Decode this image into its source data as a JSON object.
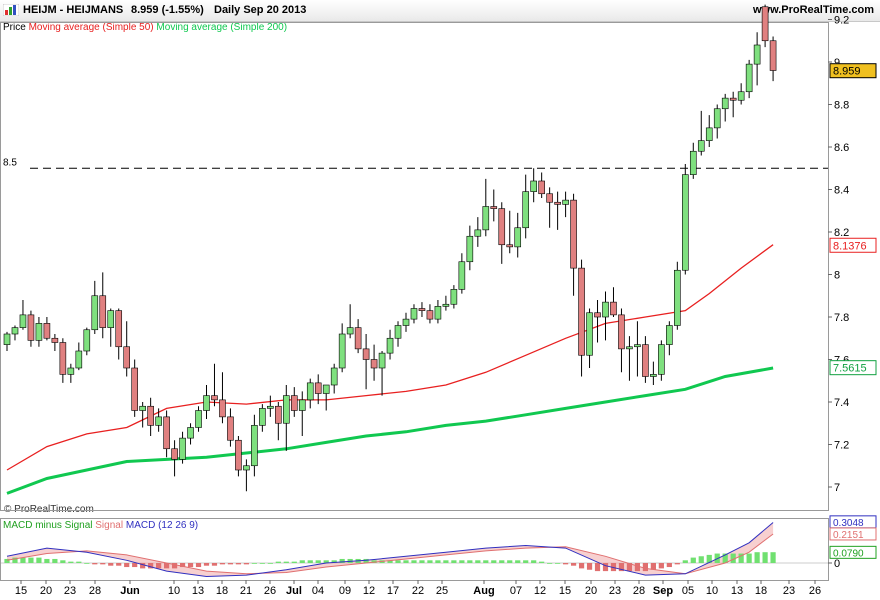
{
  "header": {
    "title": "HEIJM - HEIJMANS",
    "quote": "8.959 (-1.55%)",
    "period": "Daily  Sep 20 2013",
    "site": "www.ProRealTime.com"
  },
  "legend": {
    "price_label": "Price",
    "ma50_label": "Moving average (Simple 50)",
    "ma200_label": "Moving average (Simple 200)",
    "macd_hist_label": "MACD minus Signal",
    "macd_signal_label": "Signal",
    "macd_label": "MACD (12 26 9)"
  },
  "watermark": "© ProRealTime.com",
  "colors": {
    "up": "#7fe07f",
    "down": "#e08080",
    "ma50": "#e82020",
    "ma200": "#10c850",
    "macd_line": "#3030c0",
    "signal_line": "#e07070",
    "hist": "#70e070"
  },
  "chart_data": [
    {
      "type": "candlestick",
      "title": "HEIJM - HEIJMANS",
      "y_range": [
        6.85,
        9.3
      ],
      "y_ticks": [
        7,
        7.2,
        7.4,
        7.6,
        7.8,
        8,
        8.2,
        8.4,
        8.6,
        8.8,
        9,
        9.2
      ],
      "reference_line": {
        "value": 8.5,
        "label": "8.5"
      },
      "x_tick_labels": [
        "15",
        "20",
        "23",
        "28",
        "Jun",
        "10",
        "13",
        "18",
        "21",
        "26",
        "Jul",
        "04",
        "09",
        "12",
        "17",
        "22",
        "25",
        "Aug",
        "07",
        "12",
        "15",
        "20",
        "23",
        "28",
        "Sep",
        "05",
        "10",
        "13",
        "18",
        "23",
        "26"
      ],
      "last_values": {
        "price": "8.959",
        "ma50": "8.1376",
        "ma200": "7.5615"
      },
      "candles": [
        {
          "o": 7.67,
          "h": 7.73,
          "l": 7.64,
          "c": 7.72
        },
        {
          "o": 7.72,
          "h": 7.76,
          "l": 7.69,
          "c": 7.75
        },
        {
          "o": 7.75,
          "h": 7.88,
          "l": 7.74,
          "c": 7.81
        },
        {
          "o": 7.81,
          "h": 7.83,
          "l": 7.66,
          "c": 7.69
        },
        {
          "o": 7.69,
          "h": 7.8,
          "l": 7.66,
          "c": 7.77
        },
        {
          "o": 7.77,
          "h": 7.8,
          "l": 7.69,
          "c": 7.7
        },
        {
          "o": 7.7,
          "h": 7.72,
          "l": 7.64,
          "c": 7.68
        },
        {
          "o": 7.68,
          "h": 7.7,
          "l": 7.49,
          "c": 7.53
        },
        {
          "o": 7.53,
          "h": 7.58,
          "l": 7.49,
          "c": 7.56
        },
        {
          "o": 7.56,
          "h": 7.68,
          "l": 7.55,
          "c": 7.64
        },
        {
          "o": 7.64,
          "h": 7.75,
          "l": 7.62,
          "c": 7.74
        },
        {
          "o": 7.74,
          "h": 7.97,
          "l": 7.72,
          "c": 7.9
        },
        {
          "o": 7.9,
          "h": 8.01,
          "l": 7.7,
          "c": 7.75
        },
        {
          "o": 7.75,
          "h": 7.84,
          "l": 7.66,
          "c": 7.83
        },
        {
          "o": 7.83,
          "h": 7.84,
          "l": 7.6,
          "c": 7.66
        },
        {
          "o": 7.66,
          "h": 7.78,
          "l": 7.52,
          "c": 7.56
        },
        {
          "o": 7.56,
          "h": 7.6,
          "l": 7.33,
          "c": 7.36
        },
        {
          "o": 7.36,
          "h": 7.4,
          "l": 7.28,
          "c": 7.38
        },
        {
          "o": 7.38,
          "h": 7.42,
          "l": 7.24,
          "c": 7.29
        },
        {
          "o": 7.29,
          "h": 7.37,
          "l": 7.26,
          "c": 7.33
        },
        {
          "o": 7.33,
          "h": 7.36,
          "l": 7.14,
          "c": 7.18
        },
        {
          "o": 7.18,
          "h": 7.22,
          "l": 7.05,
          "c": 7.13
        },
        {
          "o": 7.13,
          "h": 7.26,
          "l": 7.11,
          "c": 7.23
        },
        {
          "o": 7.23,
          "h": 7.3,
          "l": 7.2,
          "c": 7.28
        },
        {
          "o": 7.28,
          "h": 7.38,
          "l": 7.26,
          "c": 7.36
        },
        {
          "o": 7.36,
          "h": 7.48,
          "l": 7.32,
          "c": 7.43
        },
        {
          "o": 7.43,
          "h": 7.58,
          "l": 7.38,
          "c": 7.41
        },
        {
          "o": 7.41,
          "h": 7.54,
          "l": 7.3,
          "c": 7.33
        },
        {
          "o": 7.33,
          "h": 7.37,
          "l": 7.19,
          "c": 7.22
        },
        {
          "o": 7.22,
          "h": 7.24,
          "l": 7.05,
          "c": 7.08
        },
        {
          "o": 7.08,
          "h": 7.13,
          "l": 6.98,
          "c": 7.1
        },
        {
          "o": 7.1,
          "h": 7.34,
          "l": 7.05,
          "c": 7.29
        },
        {
          "o": 7.29,
          "h": 7.39,
          "l": 7.26,
          "c": 7.37
        },
        {
          "o": 7.37,
          "h": 7.43,
          "l": 7.33,
          "c": 7.38
        },
        {
          "o": 7.38,
          "h": 7.4,
          "l": 7.22,
          "c": 7.3
        },
        {
          "o": 7.3,
          "h": 7.48,
          "l": 7.17,
          "c": 7.43
        },
        {
          "o": 7.43,
          "h": 7.47,
          "l": 7.33,
          "c": 7.36
        },
        {
          "o": 7.36,
          "h": 7.45,
          "l": 7.24,
          "c": 7.41
        },
        {
          "o": 7.41,
          "h": 7.51,
          "l": 7.37,
          "c": 7.49
        },
        {
          "o": 7.49,
          "h": 7.53,
          "l": 7.39,
          "c": 7.44
        },
        {
          "o": 7.44,
          "h": 7.48,
          "l": 7.36,
          "c": 7.48
        },
        {
          "o": 7.48,
          "h": 7.58,
          "l": 7.44,
          "c": 7.56
        },
        {
          "o": 7.56,
          "h": 7.77,
          "l": 7.54,
          "c": 7.72
        },
        {
          "o": 7.72,
          "h": 7.86,
          "l": 7.7,
          "c": 7.75
        },
        {
          "o": 7.75,
          "h": 7.79,
          "l": 7.63,
          "c": 7.65
        },
        {
          "o": 7.65,
          "h": 7.72,
          "l": 7.46,
          "c": 7.6
        },
        {
          "o": 7.6,
          "h": 7.67,
          "l": 7.5,
          "c": 7.56
        },
        {
          "o": 7.56,
          "h": 7.64,
          "l": 7.43,
          "c": 7.63
        },
        {
          "o": 7.63,
          "h": 7.74,
          "l": 7.6,
          "c": 7.7
        },
        {
          "o": 7.7,
          "h": 7.78,
          "l": 7.66,
          "c": 7.76
        },
        {
          "o": 7.76,
          "h": 7.82,
          "l": 7.73,
          "c": 7.79
        },
        {
          "o": 7.79,
          "h": 7.86,
          "l": 7.77,
          "c": 7.84
        },
        {
          "o": 7.84,
          "h": 7.87,
          "l": 7.8,
          "c": 7.83
        },
        {
          "o": 7.83,
          "h": 7.86,
          "l": 7.77,
          "c": 7.79
        },
        {
          "o": 7.79,
          "h": 7.88,
          "l": 7.77,
          "c": 7.85
        },
        {
          "o": 7.85,
          "h": 7.9,
          "l": 7.83,
          "c": 7.86
        },
        {
          "o": 7.86,
          "h": 7.95,
          "l": 7.84,
          "c": 7.93
        },
        {
          "o": 7.93,
          "h": 8.1,
          "l": 7.91,
          "c": 8.06
        },
        {
          "o": 8.06,
          "h": 8.23,
          "l": 8.02,
          "c": 8.18
        },
        {
          "o": 8.18,
          "h": 8.27,
          "l": 8.13,
          "c": 8.21
        },
        {
          "o": 8.21,
          "h": 8.45,
          "l": 8.18,
          "c": 8.32
        },
        {
          "o": 8.32,
          "h": 8.4,
          "l": 8.25,
          "c": 8.31
        },
        {
          "o": 8.31,
          "h": 8.34,
          "l": 8.05,
          "c": 8.14
        },
        {
          "o": 8.14,
          "h": 8.3,
          "l": 8.1,
          "c": 8.13
        },
        {
          "o": 8.13,
          "h": 8.29,
          "l": 8.08,
          "c": 8.22
        },
        {
          "o": 8.22,
          "h": 8.47,
          "l": 8.17,
          "c": 8.39
        },
        {
          "o": 8.39,
          "h": 8.5,
          "l": 8.34,
          "c": 8.44
        },
        {
          "o": 8.44,
          "h": 8.48,
          "l": 8.36,
          "c": 8.38
        },
        {
          "o": 8.38,
          "h": 8.41,
          "l": 8.22,
          "c": 8.34
        },
        {
          "o": 8.34,
          "h": 8.39,
          "l": 8.21,
          "c": 8.33
        },
        {
          "o": 8.33,
          "h": 8.39,
          "l": 8.27,
          "c": 8.35
        },
        {
          "o": 8.35,
          "h": 8.38,
          "l": 7.9,
          "c": 8.03
        },
        {
          "o": 8.03,
          "h": 8.07,
          "l": 7.52,
          "c": 7.62
        },
        {
          "o": 7.62,
          "h": 7.84,
          "l": 7.56,
          "c": 7.82
        },
        {
          "o": 7.82,
          "h": 7.88,
          "l": 7.68,
          "c": 7.8
        },
        {
          "o": 7.8,
          "h": 7.92,
          "l": 7.69,
          "c": 7.87
        },
        {
          "o": 7.87,
          "h": 7.94,
          "l": 7.8,
          "c": 7.81
        },
        {
          "o": 7.81,
          "h": 7.84,
          "l": 7.54,
          "c": 7.65
        },
        {
          "o": 7.65,
          "h": 7.71,
          "l": 7.5,
          "c": 7.66
        },
        {
          "o": 7.66,
          "h": 7.78,
          "l": 7.52,
          "c": 7.67
        },
        {
          "o": 7.67,
          "h": 7.71,
          "l": 7.49,
          "c": 7.52
        },
        {
          "o": 7.52,
          "h": 7.59,
          "l": 7.48,
          "c": 7.53
        },
        {
          "o": 7.53,
          "h": 7.69,
          "l": 7.5,
          "c": 7.67
        },
        {
          "o": 7.67,
          "h": 7.78,
          "l": 7.62,
          "c": 7.76
        },
        {
          "o": 7.76,
          "h": 8.06,
          "l": 7.74,
          "c": 8.02
        },
        {
          "o": 8.02,
          "h": 8.52,
          "l": 8.0,
          "c": 8.47
        },
        {
          "o": 8.47,
          "h": 8.62,
          "l": 8.45,
          "c": 8.58
        },
        {
          "o": 8.58,
          "h": 8.77,
          "l": 8.56,
          "c": 8.63
        },
        {
          "o": 8.63,
          "h": 8.75,
          "l": 8.6,
          "c": 8.69
        },
        {
          "o": 8.69,
          "h": 8.8,
          "l": 8.64,
          "c": 8.78
        },
        {
          "o": 8.78,
          "h": 8.85,
          "l": 8.72,
          "c": 8.83
        },
        {
          "o": 8.83,
          "h": 8.86,
          "l": 8.74,
          "c": 8.82
        },
        {
          "o": 8.82,
          "h": 8.9,
          "l": 8.8,
          "c": 8.86
        },
        {
          "o": 8.86,
          "h": 9.01,
          "l": 8.83,
          "c": 8.99
        },
        {
          "o": 8.99,
          "h": 9.14,
          "l": 8.89,
          "c": 9.08
        },
        {
          "o": 9.26,
          "h": 9.27,
          "l": 9.07,
          "c": 9.1
        },
        {
          "o": 9.1,
          "h": 9.12,
          "l": 8.91,
          "c": 8.96
        }
      ],
      "series": [
        {
          "name": "Moving average (Simple 50)",
          "color": "#e82020",
          "points": [
            [
              0,
              7.08
            ],
            [
              5,
              7.19
            ],
            [
              10,
              7.25
            ],
            [
              15,
              7.28
            ],
            [
              20,
              7.37
            ],
            [
              25,
              7.4
            ],
            [
              30,
              7.39
            ],
            [
              35,
              7.41
            ],
            [
              40,
              7.41
            ],
            [
              45,
              7.43
            ],
            [
              50,
              7.45
            ],
            [
              55,
              7.48
            ],
            [
              60,
              7.54
            ],
            [
              65,
              7.62
            ],
            [
              70,
              7.7
            ],
            [
              75,
              7.77
            ],
            [
              80,
              7.8
            ],
            [
              85,
              7.83
            ],
            [
              88,
              7.91
            ],
            [
              92,
              8.03
            ],
            [
              96,
              8.14
            ]
          ]
        },
        {
          "name": "Moving average (Simple 200)",
          "color": "#10c850",
          "points": [
            [
              0,
              6.97
            ],
            [
              5,
              7.04
            ],
            [
              10,
              7.08
            ],
            [
              15,
              7.12
            ],
            [
              20,
              7.13
            ],
            [
              25,
              7.14
            ],
            [
              30,
              7.16
            ],
            [
              35,
              7.18
            ],
            [
              40,
              7.21
            ],
            [
              45,
              7.24
            ],
            [
              50,
              7.26
            ],
            [
              55,
              7.29
            ],
            [
              60,
              7.31
            ],
            [
              65,
              7.34
            ],
            [
              70,
              7.37
            ],
            [
              75,
              7.4
            ],
            [
              80,
              7.43
            ],
            [
              85,
              7.46
            ],
            [
              90,
              7.52
            ],
            [
              96,
              7.56
            ]
          ]
        }
      ]
    },
    {
      "type": "macd",
      "title": "MACD (12 26 9)",
      "y_ticks": [
        0
      ],
      "last_values": {
        "macd": "0.3048",
        "signal": "0.2151",
        "hist": "0.0790"
      },
      "series": [
        {
          "name": "MACD",
          "color": "#3030c0",
          "points": [
            [
              0,
              0.05
            ],
            [
              5,
              0.11
            ],
            [
              10,
              0.08
            ],
            [
              15,
              0.02
            ],
            [
              20,
              -0.06
            ],
            [
              25,
              -0.1
            ],
            [
              30,
              -0.09
            ],
            [
              35,
              -0.05
            ],
            [
              40,
              0.0
            ],
            [
              45,
              0.02
            ],
            [
              50,
              0.05
            ],
            [
              55,
              0.08
            ],
            [
              60,
              0.11
            ],
            [
              65,
              0.13
            ],
            [
              70,
              0.11
            ],
            [
              75,
              -0.02
            ],
            [
              80,
              -0.09
            ],
            [
              85,
              -0.08
            ],
            [
              90,
              0.06
            ],
            [
              93,
              0.15
            ],
            [
              96,
              0.3
            ]
          ]
        },
        {
          "name": "Signal",
          "color": "#e07070",
          "points": [
            [
              0,
              0.02
            ],
            [
              5,
              0.07
            ],
            [
              10,
              0.09
            ],
            [
              15,
              0.06
            ],
            [
              20,
              0.0
            ],
            [
              25,
              -0.06
            ],
            [
              30,
              -0.08
            ],
            [
              35,
              -0.07
            ],
            [
              40,
              -0.03
            ],
            [
              45,
              0.0
            ],
            [
              50,
              0.03
            ],
            [
              55,
              0.06
            ],
            [
              60,
              0.09
            ],
            [
              65,
              0.11
            ],
            [
              70,
              0.12
            ],
            [
              75,
              0.05
            ],
            [
              80,
              -0.04
            ],
            [
              85,
              -0.08
            ],
            [
              90,
              0.0
            ],
            [
              93,
              0.08
            ],
            [
              96,
              0.2151
            ]
          ]
        }
      ],
      "histogram": [
        0.03,
        0.04,
        0.04,
        0.04,
        0.04,
        0.03,
        0.03,
        0.02,
        0.01,
        0.01,
        0.0,
        -0.01,
        -0.01,
        -0.02,
        -0.02,
        -0.03,
        -0.03,
        -0.04,
        -0.04,
        -0.04,
        -0.04,
        -0.04,
        -0.03,
        -0.03,
        -0.03,
        -0.02,
        -0.02,
        -0.01,
        -0.01,
        -0.01,
        -0.01,
        0.0,
        0.0,
        0.0,
        0.01,
        0.01,
        0.01,
        0.02,
        0.02,
        0.02,
        0.02,
        0.02,
        0.03,
        0.03,
        0.03,
        0.03,
        0.02,
        0.02,
        0.02,
        0.02,
        0.02,
        0.02,
        0.02,
        0.02,
        0.02,
        0.02,
        0.02,
        0.02,
        0.02,
        0.02,
        0.02,
        0.02,
        0.02,
        0.02,
        0.02,
        0.02,
        0.02,
        0.01,
        0.0,
        0.0,
        -0.01,
        -0.02,
        -0.04,
        -0.05,
        -0.06,
        -0.06,
        -0.06,
        -0.06,
        -0.06,
        -0.06,
        -0.06,
        -0.05,
        -0.04,
        -0.03,
        -0.01,
        0.02,
        0.04,
        0.05,
        0.06,
        0.07,
        0.07,
        0.07,
        0.07,
        0.07,
        0.08,
        0.08,
        0.08
      ]
    }
  ]
}
